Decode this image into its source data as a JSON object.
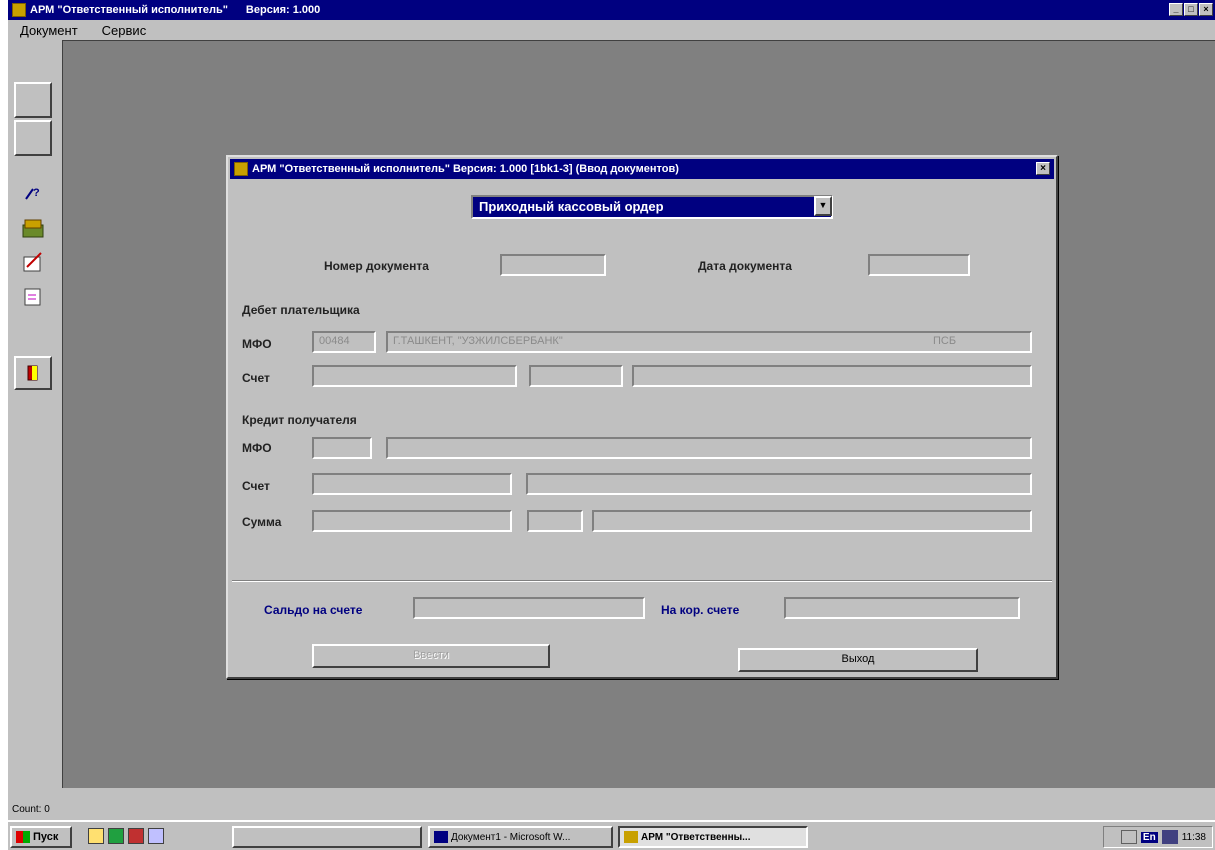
{
  "app": {
    "title": "АРМ \"Ответственный исполнитель\"",
    "version": "Версия: 1.000",
    "window_buttons": [
      "_",
      "□",
      "×"
    ]
  },
  "menubar": {
    "items": [
      "Документ",
      "Сервис"
    ]
  },
  "toolbar": {
    "icons": [
      "blank-button",
      "blank-button",
      "help-icon",
      "money-icon",
      "edit-icon",
      "document-icon",
      "exit-door-icon"
    ]
  },
  "dialog": {
    "title": "АРМ \"Ответственный исполнитель\" Версия: 1.000 [1bk1-3] (Ввод документов)",
    "close": "×",
    "doc_type": "Приходный кассовый ордер",
    "doc_number_label": "Номер документа",
    "doc_number_value": "",
    "doc_date_label": "Дата документа",
    "doc_date_value": "",
    "debit_section": "Дебет плательщика",
    "debit_mfo_label": "МФО",
    "debit_mfo_value": "00484",
    "debit_bank_value": "Г.ТАШКЕНТ, \"УЗЖИЛСБЕРБАНК\"",
    "debit_bank_suffix": "ПСБ",
    "debit_account_label": "Счет",
    "credit_section": "Кредит получателя",
    "credit_mfo_label": "МФО",
    "credit_account_label": "Счет",
    "sum_label": "Сумма",
    "balance_label": "Сальдо на счете",
    "corr_label": "На кор. счете",
    "enter_button": "Ввести",
    "exit_button": "Выход"
  },
  "statusbar": {
    "text": "Count: 0"
  },
  "taskbar": {
    "start": "Пуск",
    "tasks": [
      "Документ1 - Microsoft W...",
      "АРМ \"Ответственны..."
    ],
    "clock": "11:38",
    "lang": "En"
  }
}
